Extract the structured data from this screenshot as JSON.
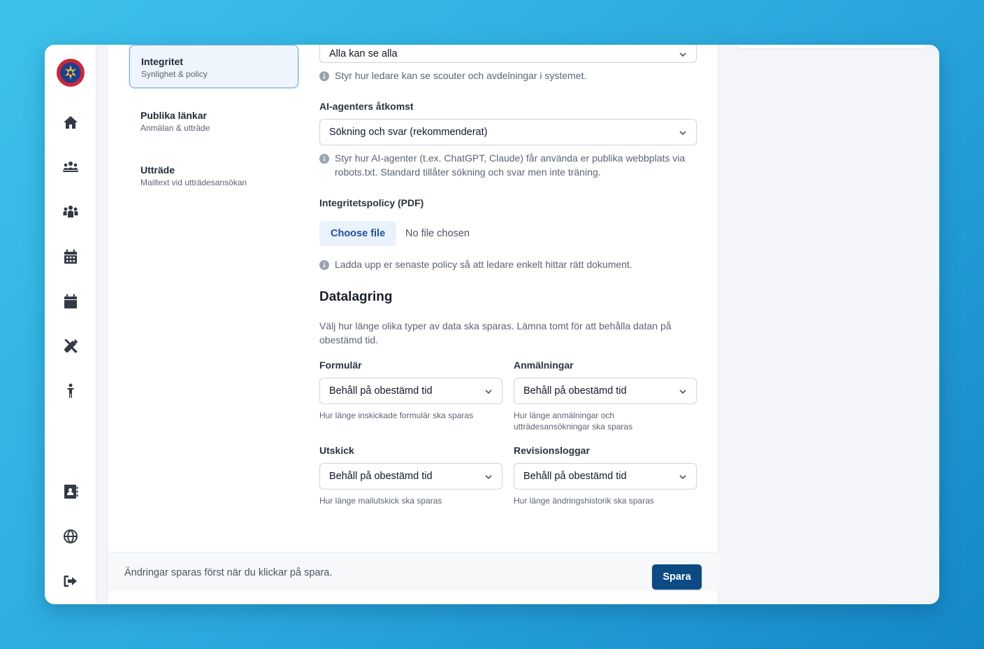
{
  "colors": {
    "accent": "#0c4a84",
    "active_nav_bg": "#eef5fd",
    "active_nav_border": "#7fb0e2",
    "file_button_bg": "#eaf2fc",
    "file_button_text": "#1f4f9b"
  },
  "sidebar": {
    "icons": [
      "house-icon",
      "group-icon",
      "people-icon",
      "calendar-grid-icon",
      "calendar-icon",
      "tools-icon",
      "child-icon",
      "contact-card-icon",
      "globe-icon",
      "logout-icon"
    ]
  },
  "subnav": {
    "items": [
      {
        "title": "Integritet",
        "subtitle": "Synlighet & policy",
        "active": true
      },
      {
        "title": "Publika länkar",
        "subtitle": "Anmälan & utträde"
      },
      {
        "title": "Utträde",
        "subtitle": "Mailtext vid utträdesansökan"
      }
    ]
  },
  "privacy": {
    "visibility_value": "Alla kan se alla",
    "visibility_help": "Styr hur ledare kan se scouter och avdelningar i systemet.",
    "ai_label": "AI-agenters åtkomst",
    "ai_value": "Sökning och svar (rekommenderat)",
    "ai_help": "Styr hur AI-agenter (t.ex. ChatGPT, Claude) får använda er publika webbplats via robots.txt. Standard tillåter sökning och svar men inte träning.",
    "policy_label": "Integritetspolicy (PDF)",
    "choose_file": "Choose file",
    "no_file": "No file chosen",
    "policy_help": "Ladda upp er senaste policy så att ledare enkelt hittar rätt dokument."
  },
  "retention": {
    "title": "Datalagring",
    "description": "Välj hur länge olika typer av data ska sparas. Lämna tomt för att behålla datan på obestämd tid.",
    "fields": [
      {
        "label": "Formulär",
        "value": "Behåll på obestämd tid",
        "help": "Hur länge inskickade formulär ska sparas"
      },
      {
        "label": "Anmälningar",
        "value": "Behåll på obestämd tid",
        "help": "Hur länge anmälningar och utträdesansökningar ska sparas"
      },
      {
        "label": "Utskick",
        "value": "Behåll på obestämd tid",
        "help": "Hur länge mailutskick ska sparas"
      },
      {
        "label": "Revisionsloggar",
        "value": "Behåll på obestämd tid",
        "help": "Hur länge ändringshistorik ska sparas"
      }
    ]
  },
  "footer": {
    "note": "Ändringar sparas först när du klickar på spara.",
    "save_label": "Spara"
  }
}
